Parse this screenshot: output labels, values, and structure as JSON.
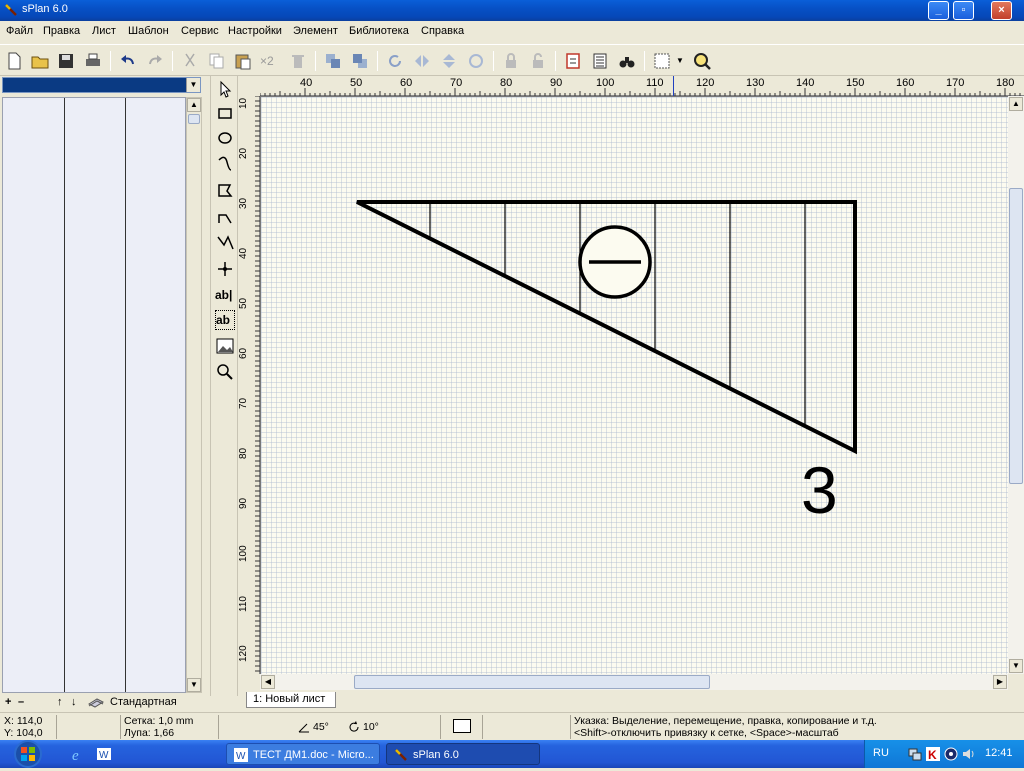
{
  "window": {
    "title": "sPlan 6.0"
  },
  "menu": [
    "Файл",
    "Правка",
    "Лист",
    "Шаблон",
    "Сервис",
    "Настройки",
    "Элемент",
    "Библиотека",
    "Справка"
  ],
  "toolbar": {
    "x2_label": "×2"
  },
  "ruler": {
    "h_labels": [
      "40",
      "50",
      "60",
      "70",
      "80",
      "90",
      "100",
      "110",
      "120",
      "130",
      "140",
      "150",
      "160",
      "170",
      "180"
    ],
    "v_labels": [
      "10",
      "20",
      "30",
      "40",
      "50",
      "60",
      "70",
      "80",
      "90",
      "100",
      "110",
      "120"
    ]
  },
  "drawing": {
    "number_label": "3"
  },
  "library": {
    "bottom_label": "Стандартная",
    "controls": [
      "+",
      "–",
      "↑",
      "↓"
    ]
  },
  "sheet_tab": "1: Новый лист",
  "status": {
    "x": "X: 114,0",
    "y": "Y: 104,0",
    "grid": "Сетка:  1,0 mm",
    "zoom": "Лупа:   1,66",
    "angle1": "45°",
    "angle2": "10°",
    "hint1": "Указка: Выделение, перемещение, правка, копирование и т.д.",
    "hint2": "<Shift>-отключить привязку к сетке, <Space>-масштаб"
  },
  "taskbar": {
    "tasks": [
      "ТЕСТ ДМ1.doc - Micro...",
      "sPlan 6.0"
    ],
    "lang": "RU",
    "clock": "12:41"
  },
  "colors": {
    "accent": "#0a5fd8",
    "canvas": "#fcfbf0",
    "taskbar": "#2563de"
  }
}
